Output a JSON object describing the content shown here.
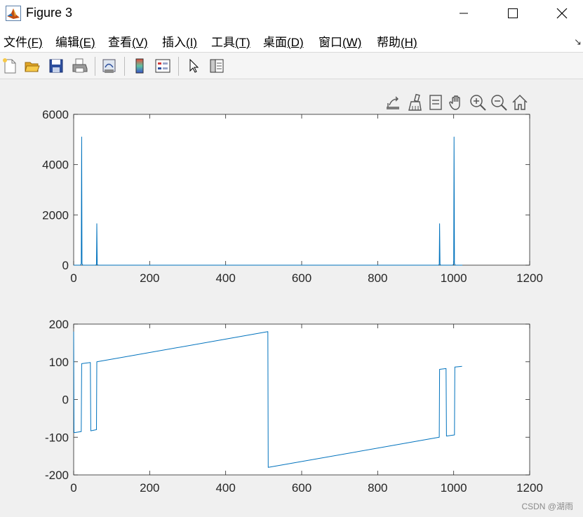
{
  "window": {
    "title": "Figure 3",
    "minimize_glyph": "—",
    "maximize_glyph": "☐",
    "close_glyph": "✕"
  },
  "menu": [
    {
      "label": "文件",
      "mnemonic": "(F)"
    },
    {
      "label": "编辑",
      "mnemonic": "(E)"
    },
    {
      "label": "查看",
      "mnemonic": "(V)"
    },
    {
      "label": "插入",
      "mnemonic": "(I)"
    },
    {
      "label": "工具",
      "mnemonic": "(T)"
    },
    {
      "label": "桌面",
      "mnemonic": "(D)"
    },
    {
      "label": "窗口",
      "mnemonic": "(W)"
    },
    {
      "label": "帮助",
      "mnemonic": "(H)"
    }
  ],
  "menu_overflow_glyph": "↘",
  "toolbar_icons": [
    "new-figure-icon",
    "open-file-icon",
    "save-icon",
    "print-icon",
    "link-plot-icon",
    "colorbar-icon",
    "legend-icon",
    "edit-plot-arrow-icon",
    "property-inspector-icon"
  ],
  "axes_toolbar_icons": [
    "export-icon",
    "data-brush-icon",
    "data-tips-icon",
    "pan-hand-icon",
    "zoom-in-icon",
    "zoom-out-icon",
    "restore-view-home-icon"
  ],
  "watermark": "CSDN @湖雨",
  "line_color": "#0072bd",
  "chart_data": [
    {
      "type": "line",
      "title": "",
      "xlabel": "",
      "ylabel": "",
      "xlim": [
        0,
        1200
      ],
      "ylim": [
        0,
        6000
      ],
      "xticks": [
        0,
        200,
        400,
        600,
        800,
        1000,
        1200
      ],
      "xtick_labels": [
        "0",
        "200",
        "400",
        "600",
        "800",
        "1000",
        "1200"
      ],
      "yticks": [
        0,
        2000,
        4000,
        6000
      ],
      "ytick_labels": [
        "0",
        "2000",
        "4000",
        "6000"
      ],
      "grid": false,
      "series": [
        {
          "x": [
            0,
            18,
            20,
            21,
            22,
            24,
            58,
            60,
            61,
            62,
            64,
            960,
            962,
            963,
            964,
            966,
            998,
            1000,
            1001,
            1002,
            1004,
            1023
          ],
          "y": [
            0,
            0,
            60,
            5100,
            60,
            0,
            0,
            30,
            1650,
            30,
            0,
            0,
            30,
            1650,
            30,
            0,
            0,
            60,
            5100,
            60,
            0,
            0
          ]
        }
      ]
    },
    {
      "type": "line",
      "title": "",
      "xlabel": "",
      "ylabel": "",
      "xlim": [
        0,
        1200
      ],
      "ylim": [
        -200,
        200
      ],
      "xticks": [
        0,
        200,
        400,
        600,
        800,
        1000,
        1200
      ],
      "xtick_labels": [
        "0",
        "200",
        "400",
        "600",
        "800",
        "1000",
        "1200"
      ],
      "yticks": [
        -200,
        -100,
        0,
        100,
        200
      ],
      "ytick_labels": [
        "-200",
        "-100",
        "0",
        "100",
        "200"
      ],
      "grid": false,
      "series": [
        {
          "x": [
            0,
            1,
            20,
            21,
            44,
            45,
            60,
            61,
            511,
            512,
            962,
            963,
            980,
            981,
            1002,
            1003,
            1022
          ],
          "y": [
            180,
            -88,
            -85,
            95,
            98,
            -83,
            -80,
            100,
            180,
            -180,
            -100,
            80,
            82,
            -97,
            -94,
            86,
            88
          ]
        }
      ]
    }
  ]
}
